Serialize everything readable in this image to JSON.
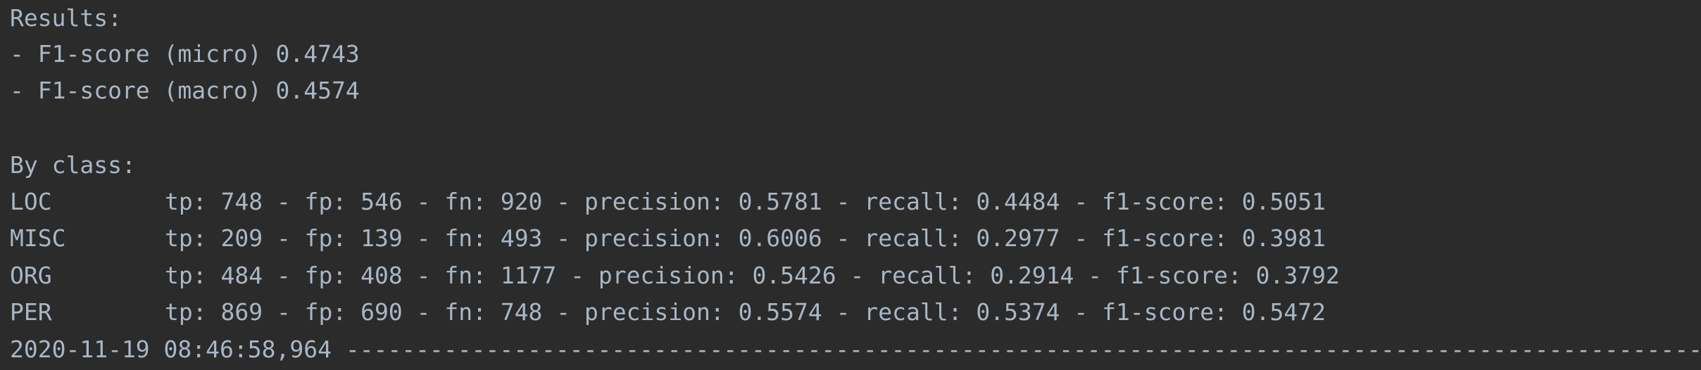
{
  "console": {
    "results_header": "Results:",
    "micro_line": "- F1-score (micro) 0.4743",
    "macro_line": "- F1-score (macro) 0.4574",
    "by_class_header": "By class:",
    "rows": [
      {
        "label": "LOC",
        "metrics": "tp: 748 - fp: 546 - fn: 920 - precision: 0.5781 - recall: 0.4484 - f1-score: 0.5051"
      },
      {
        "label": "MISC",
        "metrics": "tp: 209 - fp: 139 - fn: 493 - precision: 0.6006 - recall: 0.2977 - f1-score: 0.3981"
      },
      {
        "label": "ORG",
        "metrics": "tp: 484 - fp: 408 - fn: 1177 - precision: 0.5426 - recall: 0.2914 - f1-score: 0.3792"
      },
      {
        "label": "PER",
        "metrics": "tp: 869 - fp: 690 - fn: 748 - precision: 0.5574 - recall: 0.5374 - f1-score: 0.5472"
      }
    ],
    "log_line": "2020-11-19 08:46:58,964 ----------------------------------------------------------------------------------------------------"
  },
  "colors": {
    "background": "#2b2b2b",
    "text": "#a9b7c6"
  }
}
